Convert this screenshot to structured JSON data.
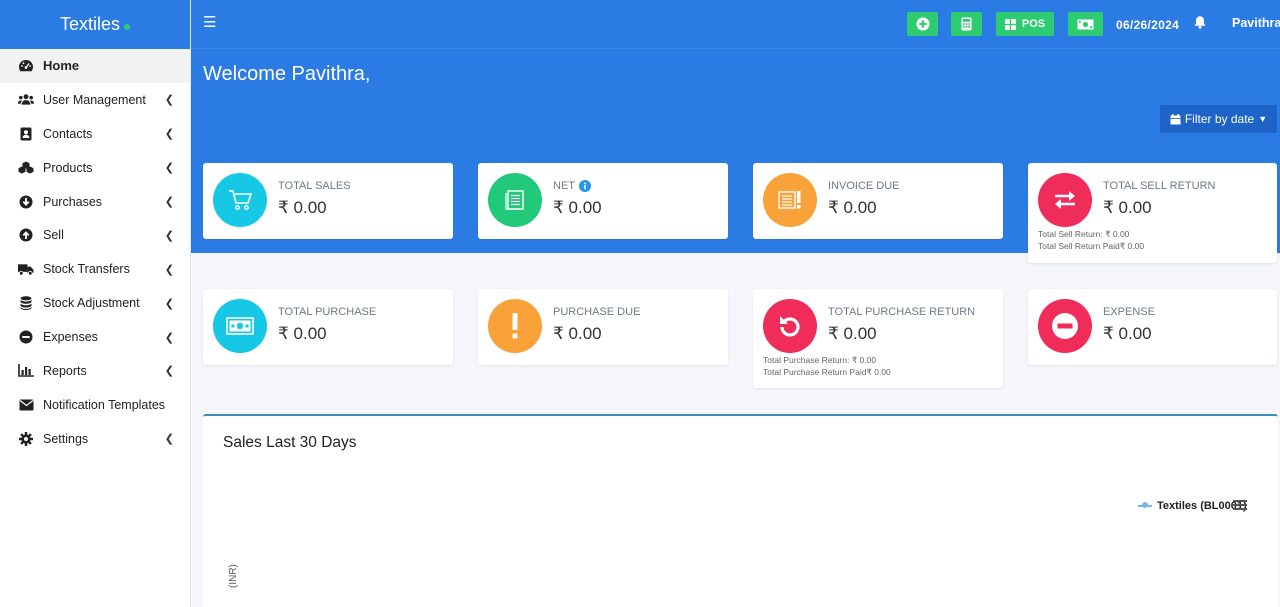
{
  "brand": {
    "name": "Textiles"
  },
  "sidebar": {
    "items": [
      {
        "label": "Home",
        "icon": "dashboard-icon",
        "active": true
      },
      {
        "label": "User Management",
        "icon": "users-icon"
      },
      {
        "label": "Contacts",
        "icon": "address-book-icon"
      },
      {
        "label": "Products",
        "icon": "cubes-icon"
      },
      {
        "label": "Purchases",
        "icon": "arrow-circle-down-icon"
      },
      {
        "label": "Sell",
        "icon": "arrow-circle-up-icon"
      },
      {
        "label": "Stock Transfers",
        "icon": "truck-icon"
      },
      {
        "label": "Stock Adjustment",
        "icon": "database-icon"
      },
      {
        "label": "Expenses",
        "icon": "minus-circle-icon"
      },
      {
        "label": "Reports",
        "icon": "bar-chart-icon"
      },
      {
        "label": "Notification Templates",
        "icon": "envelope-icon"
      },
      {
        "label": "Settings",
        "icon": "cog-icon"
      }
    ]
  },
  "topbar": {
    "pos_label": "POS",
    "date": "06/26/2024",
    "user": "Pavithra"
  },
  "hero": {
    "welcome": "Welcome Pavithra,",
    "filter_label": "Filter by date"
  },
  "cards": {
    "total_sales": {
      "label": "TOTAL SALES",
      "value": "₹ 0.00"
    },
    "net": {
      "label": "NET",
      "value": "₹ 0.00"
    },
    "invoice_due": {
      "label": "INVOICE DUE",
      "value": "₹ 0.00"
    },
    "total_sell_return": {
      "label": "TOTAL SELL RETURN",
      "value": "₹ 0.00",
      "sub1": "Total Sell Return: ₹ 0.00",
      "sub2": "Total Sell Return Paid₹ 0.00"
    },
    "total_purchase": {
      "label": "TOTAL PURCHASE",
      "value": "₹ 0.00"
    },
    "purchase_due": {
      "label": "PURCHASE DUE",
      "value": "₹ 0.00"
    },
    "total_purchase_return": {
      "label": "TOTAL PURCHASE RETURN",
      "value": "₹ 0.00",
      "sub1": "Total Purchase Return: ₹ 0.00",
      "sub2": "Total Purchase Return Paid₹ 0.00"
    },
    "expense": {
      "label": "EXPENSE",
      "value": "₹ 0.00"
    }
  },
  "chart": {
    "title": "Sales Last 30 Days",
    "legend": "Textiles (BL0001)",
    "y_label": "(INR)"
  },
  "colors": {
    "primary": "#2b7be4",
    "green": "#2ecc71",
    "cyan": "#17c8e6",
    "orange": "#f9a23a",
    "red": "#ef2c5a",
    "mint": "#23c97a"
  }
}
